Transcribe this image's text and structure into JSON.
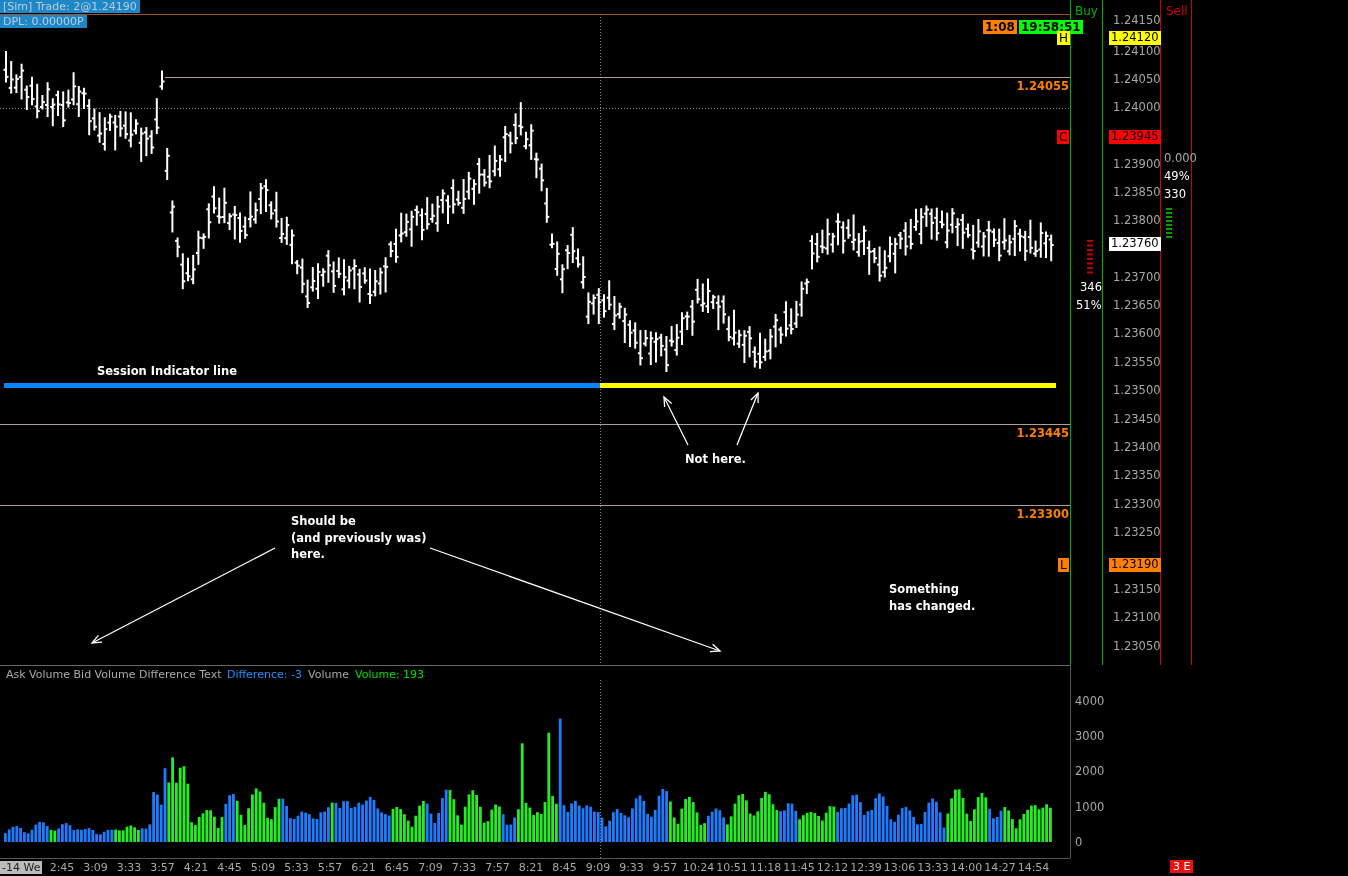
{
  "header": {
    "trade": "[Sim]  Trade: 2@1.24190",
    "dpl": "DPL: 0.00000P"
  },
  "timers": [
    {
      "text": "1:08",
      "color": "#ff8000"
    },
    {
      "text": "19:58:51",
      "color": "#00ff00"
    }
  ],
  "markers": [
    {
      "text": "H",
      "color": "#ffff00"
    },
    {
      "text": "C",
      "color": "#ff0000"
    },
    {
      "text": "L",
      "color": "#ff8000"
    }
  ],
  "level_lines": [
    {
      "label": "1.24055"
    },
    {
      "label": "1.23445"
    },
    {
      "label": "1.23300"
    }
  ],
  "annotations": [
    "Session Indicator line",
    "Not here.",
    "Should be\n(and previously was)\nhere.",
    "Something\nhas changed."
  ],
  "buy_column": {
    "title": "Buy",
    "count": "346",
    "percent": "51%"
  },
  "sell_column": {
    "title": "Sell",
    "value": "0.000",
    "percent": "49%",
    "count": "330"
  },
  "price_axis": [
    "1.24150",
    "1.24100",
    "1.24050",
    "1.24000",
    "1.23900",
    "1.23850",
    "1.23800",
    "1.23700",
    "1.23650",
    "1.23600",
    "1.23550",
    "1.23500",
    "1.23450",
    "1.23400",
    "1.23350",
    "1.23300",
    "1.23250",
    "1.23150",
    "1.23100",
    "1.23050"
  ],
  "price_tags": [
    {
      "text": "1.24120",
      "color": "#ffff00"
    },
    {
      "text": "1.23945",
      "color": "#ff0000"
    },
    {
      "text": "1.23760",
      "color": "#ffffff"
    },
    {
      "text": "1.23190",
      "color": "#ff8000"
    }
  ],
  "volume_panel": {
    "title": "Ask Volume Bid Volume Difference Text",
    "difference": "Difference: -3",
    "volume_label": "Volume",
    "volume": "Volume: 193",
    "axis": [
      "4000",
      "3000",
      "2000",
      "1000",
      "0"
    ]
  },
  "time_axis": {
    "date": "-14 We",
    "times": [
      "2:45",
      "3:09",
      "3:33",
      "3:57",
      "4:21",
      "4:45",
      "5:09",
      "5:33",
      "5:57",
      "6:21",
      "6:45",
      "7:09",
      "7:33",
      "7:57",
      "8:21",
      "8:45",
      "9:09",
      "9:33",
      "9:57",
      "10:24",
      "10:51",
      "11:18",
      "11:45",
      "12:12",
      "12:39",
      "13:06",
      "13:33",
      "14:00",
      "14:27",
      "14:54"
    ]
  },
  "status_badge": "3 E"
}
